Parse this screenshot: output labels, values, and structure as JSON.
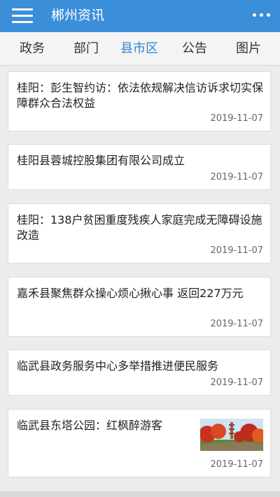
{
  "header": {
    "title": "郴州资讯",
    "menu_icon": "hamburger-menu-icon",
    "more_icon": "more-dots-icon"
  },
  "tabs": [
    {
      "label": "政务",
      "active": false
    },
    {
      "label": "部门",
      "active": false
    },
    {
      "label": "县市区",
      "active": true
    },
    {
      "label": "公告",
      "active": false
    },
    {
      "label": "图片",
      "active": false
    }
  ],
  "news": [
    {
      "title": "桂阳：彭生智约访：依法依规解决信访诉求切实保障群众合法权益",
      "date": "2019-11-07"
    },
    {
      "title": "桂阳县蓉城控股集团有限公司成立",
      "date": "2019-11-07"
    },
    {
      "title": "桂阳：138户贫困重度残疾人家庭完成无障碍设施改造",
      "date": "2019-11-07"
    },
    {
      "title": "嘉禾县聚焦群众操心烦心揪心事 返回227万元",
      "date": "2019-11-07"
    },
    {
      "title": "临武县政务服务中心多举措推进便民服务",
      "date": "2019-11-07"
    },
    {
      "title": "临武县东塔公园：红枫醉游客",
      "date": "2019-11-07",
      "thumbnail": "park-photo"
    }
  ],
  "colors": {
    "appbar": "#3b8ed8",
    "active_tab": "#2f86d6"
  }
}
